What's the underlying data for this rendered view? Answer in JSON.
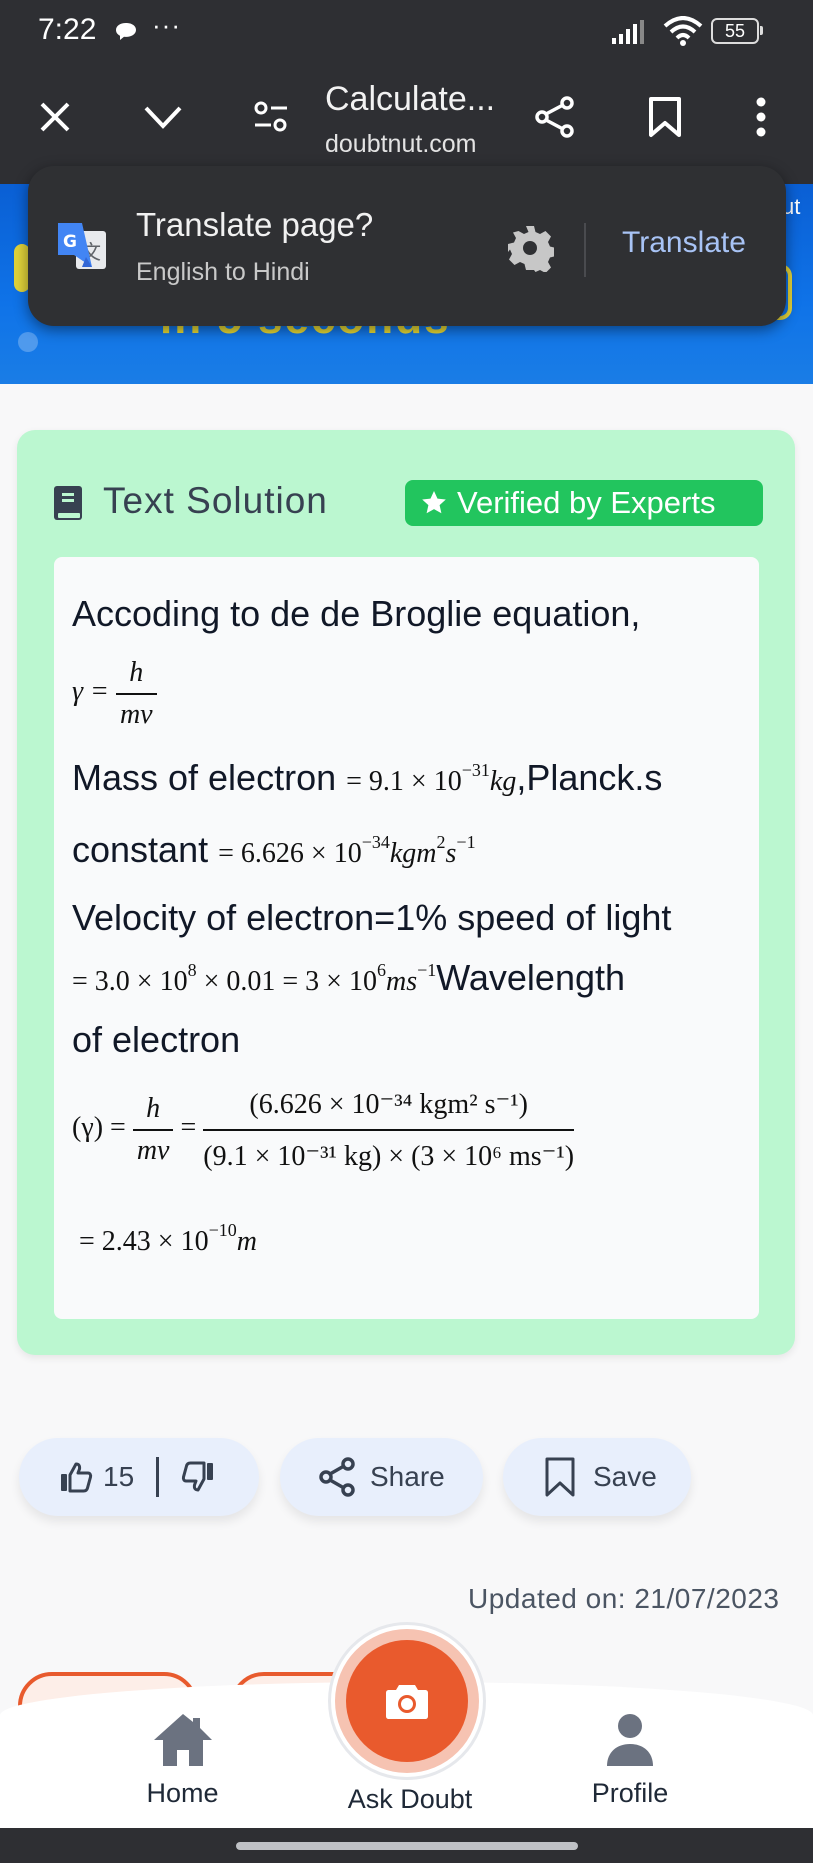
{
  "status_bar": {
    "time": "7:22",
    "more": "···",
    "battery": "55",
    "icons": [
      "chat-bubble-icon",
      "signal-icon",
      "wifi-icon",
      "battery-icon"
    ]
  },
  "browser": {
    "title": "Calculate...",
    "url": "doubtnut.com",
    "icons": [
      "close-icon",
      "chevron-down-icon",
      "page-settings-icon",
      "share-icon",
      "bookmark-icon",
      "more-vert-icon"
    ]
  },
  "banner": {
    "partial_text": "in 5 seconds",
    "corner_text": "ut"
  },
  "translate_popup": {
    "title": "Translate page?",
    "subtitle": "English to Hindi",
    "action": "Translate"
  },
  "solution": {
    "heading": "Text Solution",
    "badge": "Verified by Experts",
    "lines": {
      "intro": "Accoding to de de Broglie equation,",
      "formula_lhs": "γ =",
      "formula_num": "h",
      "formula_den": "mv",
      "mass_label": "Mass of electron",
      "mass_value": "= 9.1 × 10",
      "mass_exp": "−31",
      "mass_unit": "kg",
      "planck_label": ",Planck.s",
      "constant_label": "constant",
      "constant_value": "= 6.626 × 10",
      "constant_exp": "−34",
      "constant_unit": "kgm",
      "constant_unit_exp": "2",
      "constant_unit2": "s",
      "constant_unit2_exp": "−1",
      "velocity_label": "Velocity of electron=1% speed of light",
      "velocity_calc": "= 3.0 × 10",
      "velocity_exp1": "8",
      "velocity_calc2": " × 0.01 = 3 × 10",
      "velocity_exp2": "6",
      "velocity_unit": "ms",
      "velocity_unit_exp": "−1",
      "wavelength_label": "Wavelength",
      "of_electron": "of electron",
      "eq_lhs": "(γ) =",
      "eq_num": "h",
      "eq_den": "mv",
      "eq_eq": "=",
      "eq_big_num": "(6.626 × 10⁻³⁴ kgm² s⁻¹)",
      "eq_big_den": "(9.1 × 10⁻³¹ kg) × (3 × 10⁶ ms⁻¹)",
      "result": "= 2.43 × 10",
      "result_exp": "−10",
      "result_unit": "m"
    }
  },
  "actions": {
    "like_count": "15",
    "share_label": "Share",
    "save_label": "Save"
  },
  "updated_on": "Updated on: 21/07/2023",
  "bottom_nav": {
    "home": "Home",
    "ask": "Ask Doubt",
    "profile": "Profile"
  },
  "colors": {
    "card_bg": "#bbf7d0",
    "badge_green": "#22c55e",
    "accent_orange": "#e95a2d",
    "toolbar_dark": "#2e2f33",
    "translate_link": "#a8c3f5"
  }
}
